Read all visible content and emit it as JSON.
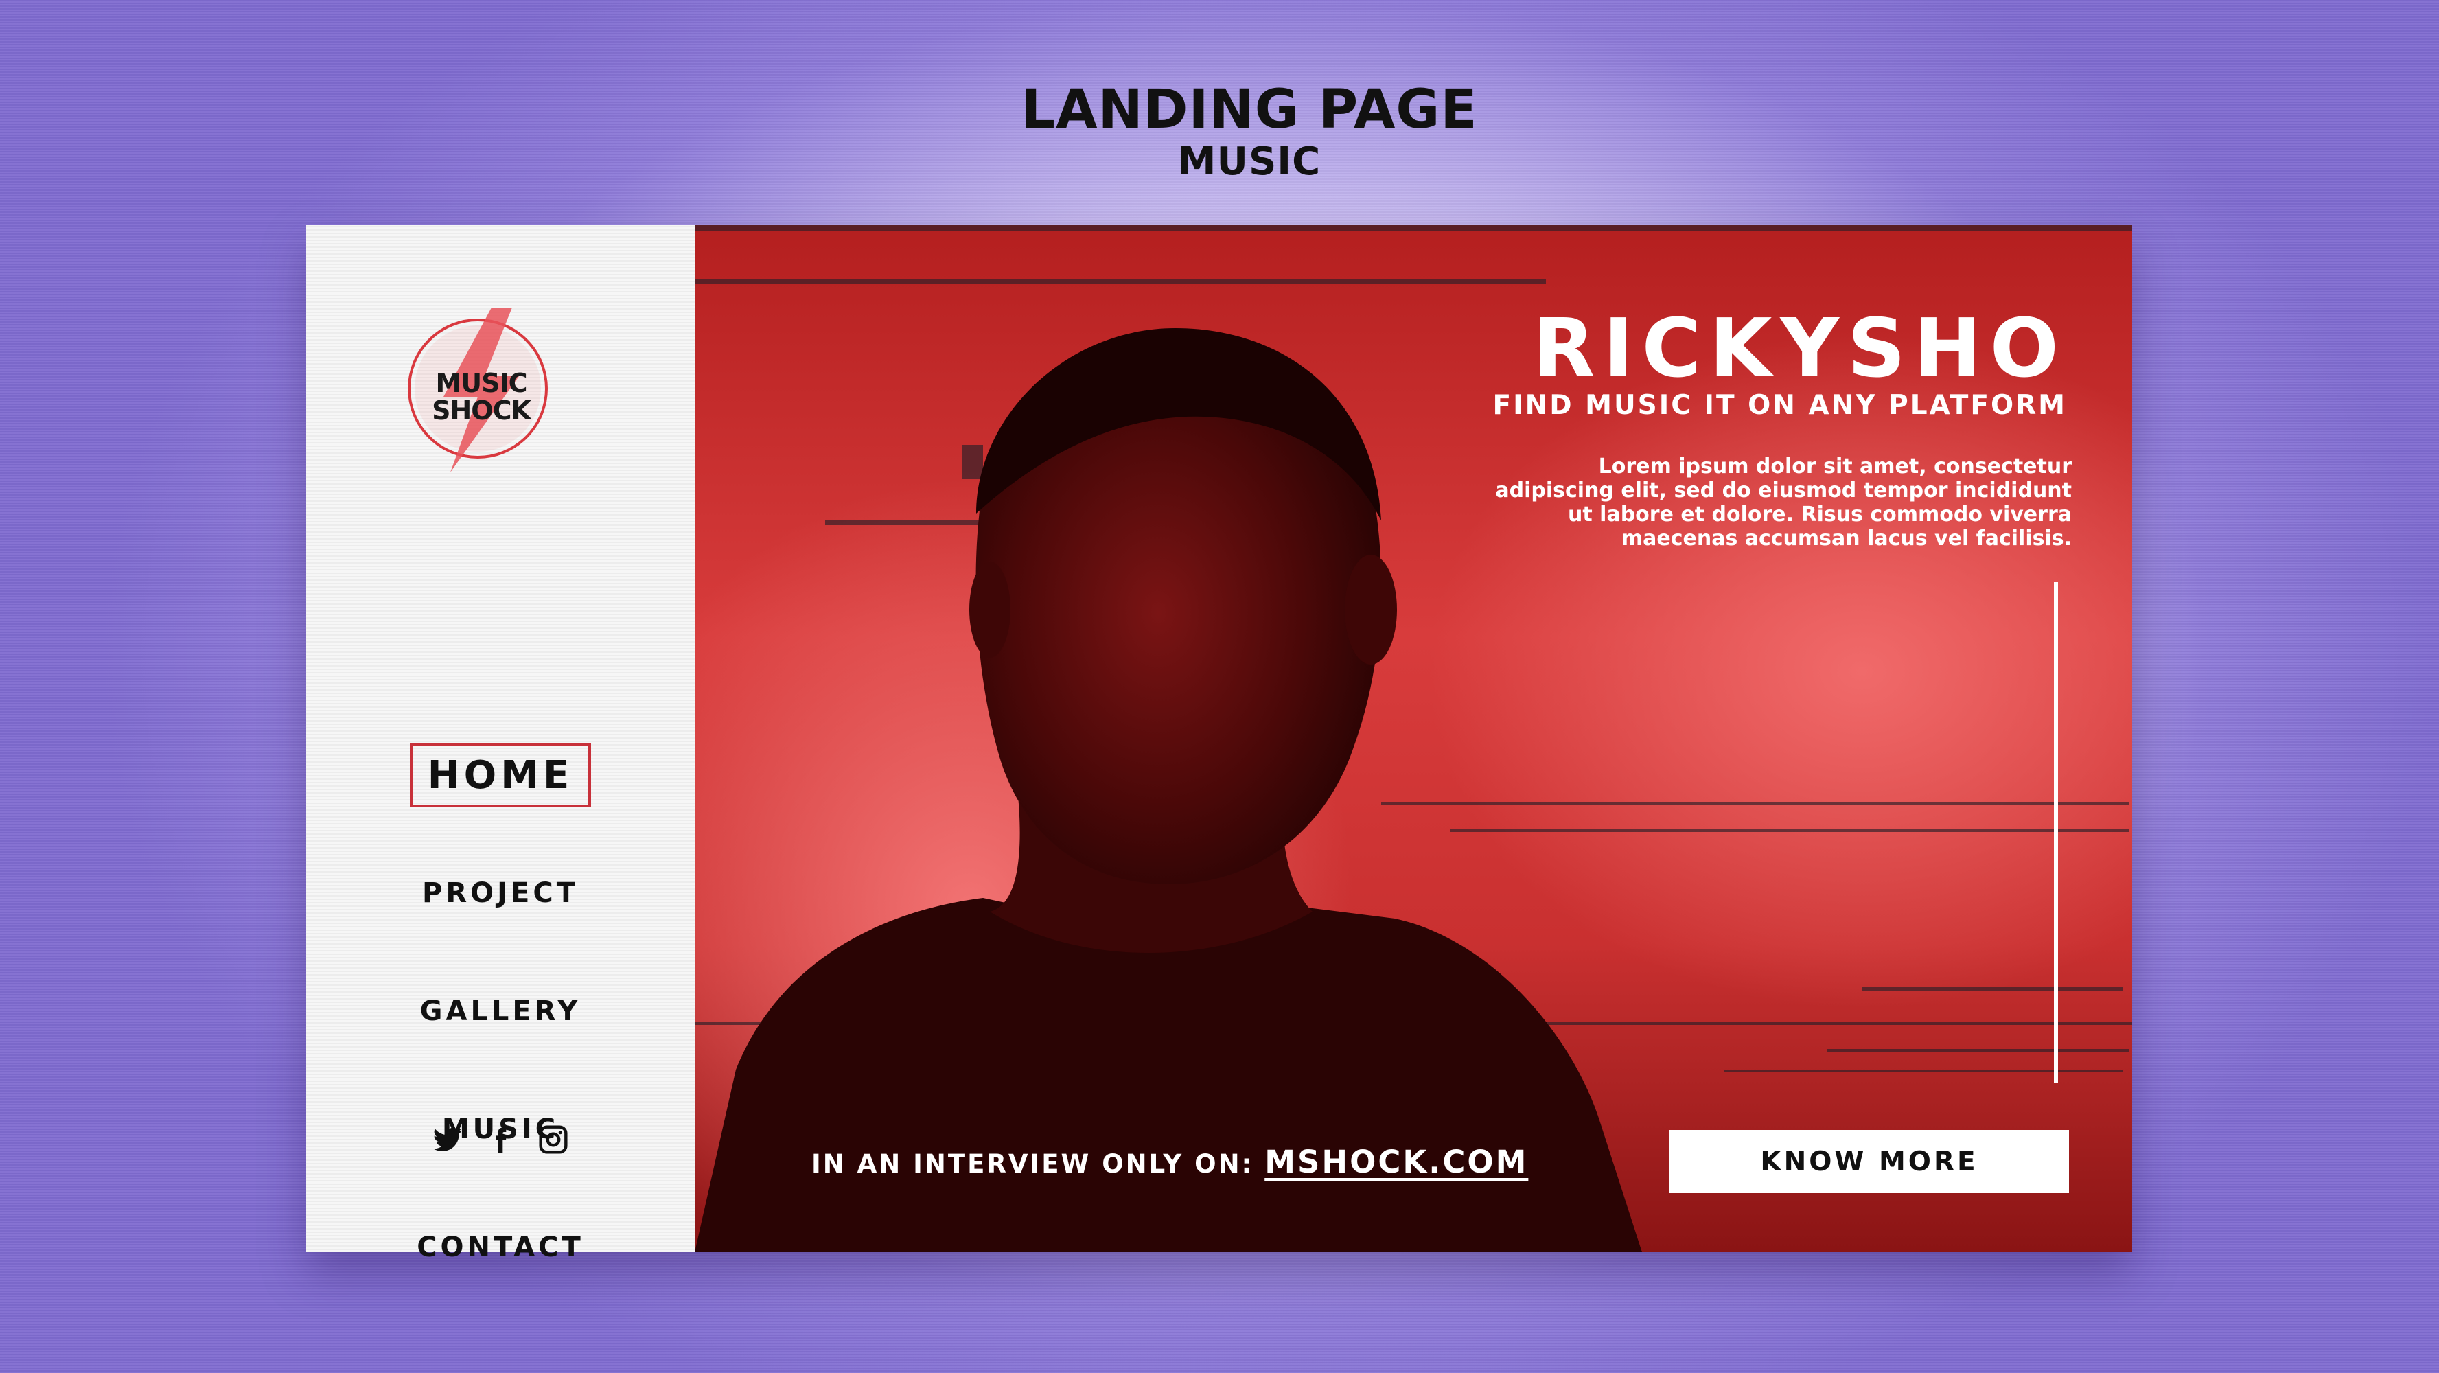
{
  "page": {
    "title": "LANDING PAGE",
    "subtitle": "MUSIC"
  },
  "brand": {
    "logo_line1": "MUSIC",
    "logo_line2": "SHOCK",
    "logo_icon": "lightning-bolt-icon",
    "accent": "#c8313a"
  },
  "nav": {
    "items": [
      {
        "label": "HOME",
        "active": true
      },
      {
        "label": "PROJECT"
      },
      {
        "label": "GALLERY"
      },
      {
        "label": "MUSIC"
      },
      {
        "label": "CONTACT"
      }
    ]
  },
  "social": {
    "icons": [
      "twitter-icon",
      "facebook-icon",
      "instagram-icon"
    ]
  },
  "hero": {
    "title": "RICKYSHO",
    "subtitle": "FIND MUSIC IT ON ANY PLATFORM",
    "body_lines": [
      "Lorem ipsum dolor sit amet, consectetur",
      "adipiscing elit, sed do eiusmod tempor incididunt",
      "ut labore et dolore. Risus commodo viverra",
      "maecenas accumsan lacus vel facilisis."
    ],
    "interview_prefix": "IN AN INTERVIEW ONLY ON:",
    "interview_link": "MSHOCK.COM",
    "cta_label": "KNOW MORE",
    "background_color": "#d13636"
  }
}
